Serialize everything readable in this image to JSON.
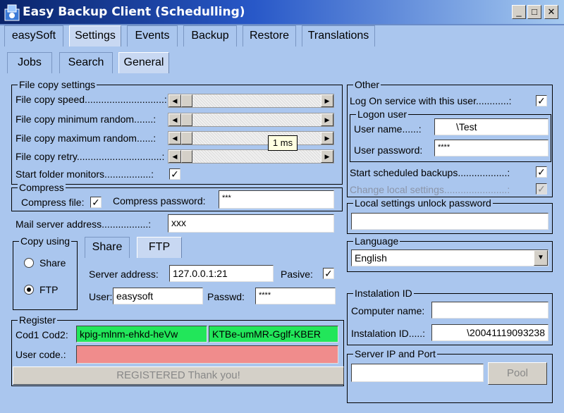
{
  "window": {
    "title": "Easy Backup Client (Schedulling)",
    "min_glyph": "_",
    "max_glyph": "□",
    "close_glyph": "✕"
  },
  "tabs": [
    "easySoft",
    "Settings",
    "Events",
    "Backup",
    "Restore",
    "Translations"
  ],
  "subtabs": [
    "Jobs",
    "Search",
    "General"
  ],
  "file_copy": {
    "title": "File copy settings",
    "speed": "File copy speed.............................:",
    "min_random": "File copy minimum random.......:",
    "max_random": "File copy maximum random......:",
    "retry": "File copy retry...............................:",
    "monitors": "Start folder monitors.................:",
    "tooltip": "1 ms"
  },
  "compress": {
    "title": "Compress",
    "file_label": "Compress file:",
    "password_label": "Compress password:",
    "password_value": "***"
  },
  "mail": {
    "label": "Mail server address.................:",
    "value": "xxx"
  },
  "copy_using": {
    "title": "Copy using",
    "share": "Share",
    "ftp": "FTP",
    "tab_share": "Share",
    "tab_ftp": "FTP",
    "server_label": "Server address:",
    "server_value": "127.0.0.1:21",
    "pasive_label": "Pasive:",
    "user_label": "User:",
    "user_value": "easysoft",
    "passwd_label": "Passwd:",
    "passwd_value": "****"
  },
  "register": {
    "title": "Register",
    "cod_label": "Cod1 Cod2:",
    "cod1": "kpig-mlnm-ehkd-heVw",
    "cod2": "KTBe-umMR-Gglf-KBER",
    "user_code_label": "User code.:",
    "status": "REGISTERED Thank you!"
  },
  "other": {
    "title": "Other",
    "logon_service": "Log On service with this user............:",
    "logon_user_title": "Logon user",
    "user_name_label": "User name......:",
    "user_name_value": "\\Test",
    "user_password_label": "User password:",
    "user_password_value": "****",
    "start_scheduled": "Start scheduled backups..................:",
    "change_local": "Change local settings.......................:",
    "unlock_title": "Local settings unlock password"
  },
  "language": {
    "title": "Language",
    "selected": "English"
  },
  "instalation": {
    "title": "Instalation ID",
    "computer_label": "Computer name:",
    "id_label": "Instalation ID.....:",
    "id_value": "\\20041119093238"
  },
  "server_ip": {
    "title": "Server IP and Port",
    "pool_button": "Pool"
  },
  "colors": {
    "background": "#aac6ee",
    "title_bar": "#0a246a",
    "green_field": "#22e65a",
    "pink_field": "#f08c8c"
  }
}
